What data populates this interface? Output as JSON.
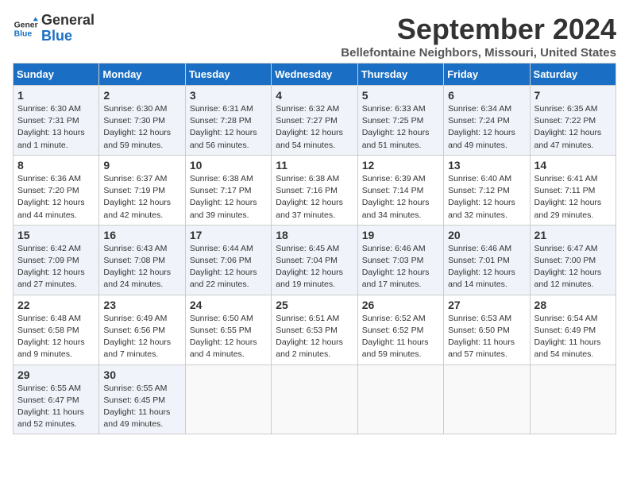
{
  "header": {
    "logo_line1": "General",
    "logo_line2": "Blue",
    "title": "September 2024",
    "subtitle": "Bellefontaine Neighbors, Missouri, United States"
  },
  "weekdays": [
    "Sunday",
    "Monday",
    "Tuesday",
    "Wednesday",
    "Thursday",
    "Friday",
    "Saturday"
  ],
  "weeks": [
    [
      {
        "day": "1",
        "info": "Sunrise: 6:30 AM\nSunset: 7:31 PM\nDaylight: 13 hours\nand 1 minute."
      },
      {
        "day": "2",
        "info": "Sunrise: 6:30 AM\nSunset: 7:30 PM\nDaylight: 12 hours\nand 59 minutes."
      },
      {
        "day": "3",
        "info": "Sunrise: 6:31 AM\nSunset: 7:28 PM\nDaylight: 12 hours\nand 56 minutes."
      },
      {
        "day": "4",
        "info": "Sunrise: 6:32 AM\nSunset: 7:27 PM\nDaylight: 12 hours\nand 54 minutes."
      },
      {
        "day": "5",
        "info": "Sunrise: 6:33 AM\nSunset: 7:25 PM\nDaylight: 12 hours\nand 51 minutes."
      },
      {
        "day": "6",
        "info": "Sunrise: 6:34 AM\nSunset: 7:24 PM\nDaylight: 12 hours\nand 49 minutes."
      },
      {
        "day": "7",
        "info": "Sunrise: 6:35 AM\nSunset: 7:22 PM\nDaylight: 12 hours\nand 47 minutes."
      }
    ],
    [
      {
        "day": "8",
        "info": "Sunrise: 6:36 AM\nSunset: 7:20 PM\nDaylight: 12 hours\nand 44 minutes."
      },
      {
        "day": "9",
        "info": "Sunrise: 6:37 AM\nSunset: 7:19 PM\nDaylight: 12 hours\nand 42 minutes."
      },
      {
        "day": "10",
        "info": "Sunrise: 6:38 AM\nSunset: 7:17 PM\nDaylight: 12 hours\nand 39 minutes."
      },
      {
        "day": "11",
        "info": "Sunrise: 6:38 AM\nSunset: 7:16 PM\nDaylight: 12 hours\nand 37 minutes."
      },
      {
        "day": "12",
        "info": "Sunrise: 6:39 AM\nSunset: 7:14 PM\nDaylight: 12 hours\nand 34 minutes."
      },
      {
        "day": "13",
        "info": "Sunrise: 6:40 AM\nSunset: 7:12 PM\nDaylight: 12 hours\nand 32 minutes."
      },
      {
        "day": "14",
        "info": "Sunrise: 6:41 AM\nSunset: 7:11 PM\nDaylight: 12 hours\nand 29 minutes."
      }
    ],
    [
      {
        "day": "15",
        "info": "Sunrise: 6:42 AM\nSunset: 7:09 PM\nDaylight: 12 hours\nand 27 minutes."
      },
      {
        "day": "16",
        "info": "Sunrise: 6:43 AM\nSunset: 7:08 PM\nDaylight: 12 hours\nand 24 minutes."
      },
      {
        "day": "17",
        "info": "Sunrise: 6:44 AM\nSunset: 7:06 PM\nDaylight: 12 hours\nand 22 minutes."
      },
      {
        "day": "18",
        "info": "Sunrise: 6:45 AM\nSunset: 7:04 PM\nDaylight: 12 hours\nand 19 minutes."
      },
      {
        "day": "19",
        "info": "Sunrise: 6:46 AM\nSunset: 7:03 PM\nDaylight: 12 hours\nand 17 minutes."
      },
      {
        "day": "20",
        "info": "Sunrise: 6:46 AM\nSunset: 7:01 PM\nDaylight: 12 hours\nand 14 minutes."
      },
      {
        "day": "21",
        "info": "Sunrise: 6:47 AM\nSunset: 7:00 PM\nDaylight: 12 hours\nand 12 minutes."
      }
    ],
    [
      {
        "day": "22",
        "info": "Sunrise: 6:48 AM\nSunset: 6:58 PM\nDaylight: 12 hours\nand 9 minutes."
      },
      {
        "day": "23",
        "info": "Sunrise: 6:49 AM\nSunset: 6:56 PM\nDaylight: 12 hours\nand 7 minutes."
      },
      {
        "day": "24",
        "info": "Sunrise: 6:50 AM\nSunset: 6:55 PM\nDaylight: 12 hours\nand 4 minutes."
      },
      {
        "day": "25",
        "info": "Sunrise: 6:51 AM\nSunset: 6:53 PM\nDaylight: 12 hours\nand 2 minutes."
      },
      {
        "day": "26",
        "info": "Sunrise: 6:52 AM\nSunset: 6:52 PM\nDaylight: 11 hours\nand 59 minutes."
      },
      {
        "day": "27",
        "info": "Sunrise: 6:53 AM\nSunset: 6:50 PM\nDaylight: 11 hours\nand 57 minutes."
      },
      {
        "day": "28",
        "info": "Sunrise: 6:54 AM\nSunset: 6:49 PM\nDaylight: 11 hours\nand 54 minutes."
      }
    ],
    [
      {
        "day": "29",
        "info": "Sunrise: 6:55 AM\nSunset: 6:47 PM\nDaylight: 11 hours\nand 52 minutes."
      },
      {
        "day": "30",
        "info": "Sunrise: 6:55 AM\nSunset: 6:45 PM\nDaylight: 11 hours\nand 49 minutes."
      },
      {
        "day": "",
        "info": ""
      },
      {
        "day": "",
        "info": ""
      },
      {
        "day": "",
        "info": ""
      },
      {
        "day": "",
        "info": ""
      },
      {
        "day": "",
        "info": ""
      }
    ]
  ]
}
